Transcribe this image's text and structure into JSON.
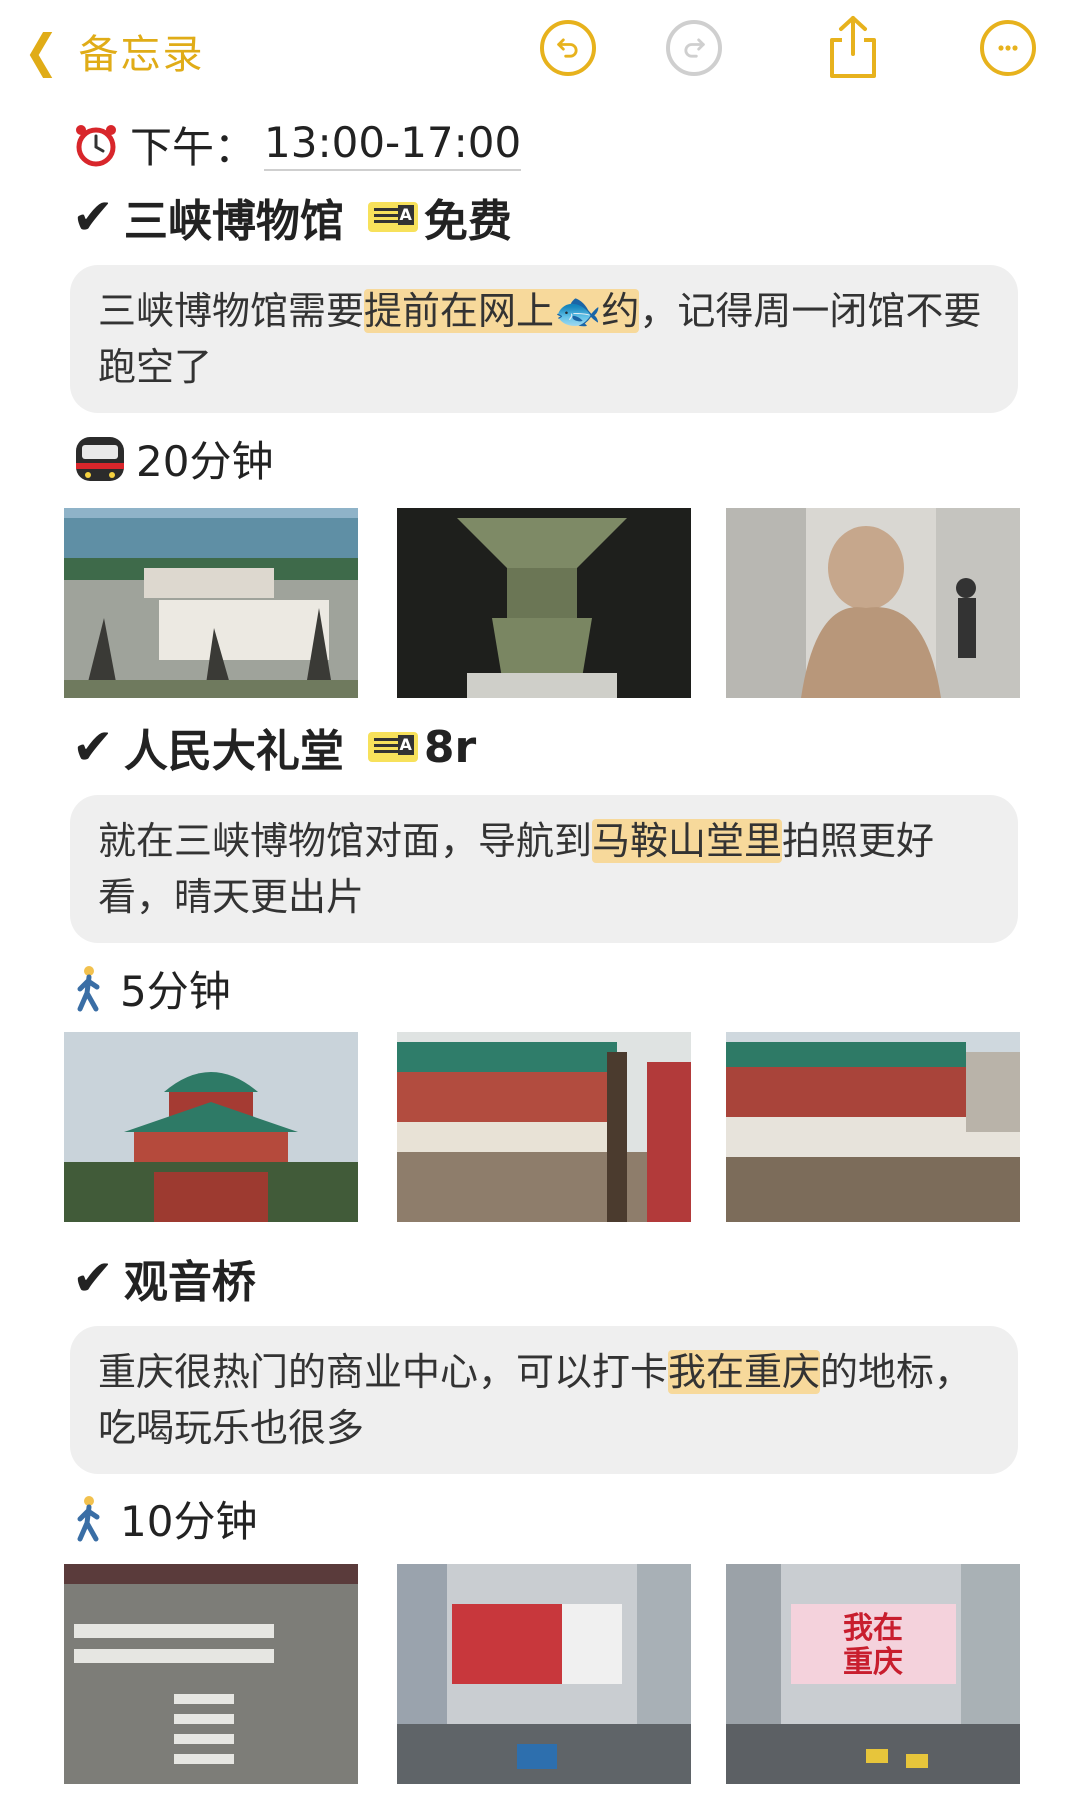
{
  "nav": {
    "back_label": "备忘录"
  },
  "note": {
    "time_label": "下午：",
    "time_value": "13:00-17:00",
    "sections": [
      {
        "title": "三峡博物馆",
        "price": "免费",
        "card_before": "三峡博物馆需要",
        "card_highlight": "提前在网上🐟约",
        "card_after": "，记得周一闭馆不要跑空了",
        "travel": "20分钟",
        "photos": [
          "museum-exterior-photo",
          "bronze-vessel-photo",
          "stone-statue-photo"
        ]
      },
      {
        "title": "人民大礼堂",
        "price": "8r",
        "card_before": "就在三峡博物馆对面，导航到",
        "card_highlight": "马鞍山堂里",
        "card_after": "拍照更好看，晴天更出片",
        "travel": "5分钟",
        "photos": [
          "great-hall-photo",
          "hall-closeup-photo",
          "hall-side-photo"
        ]
      },
      {
        "title": "观音桥",
        "card_before": "重庆很热门的商业中心，可以打卡",
        "card_highlight": "我在重庆",
        "card_after": "的地标，吃喝玩乐也很多",
        "travel": "10分钟",
        "photos": [
          "plaza-crossing-photo",
          "street-billboard-photo",
          "wozai-chongqing-photo"
        ],
        "billboard_text": "我在重庆"
      }
    ]
  },
  "colors": {
    "accent": "#e7b21d",
    "card_bg": "#efefef",
    "highlight": "#f7d99b"
  }
}
